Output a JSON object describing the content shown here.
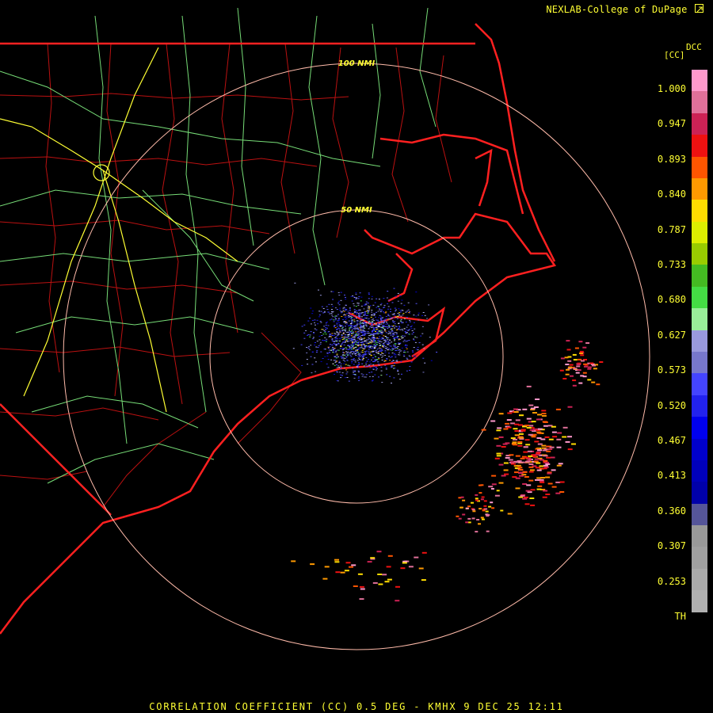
{
  "credit": "NEXLAB-College of DuPage",
  "credit_icon": "external-link-icon",
  "footer": "CORRELATION COEFFICIENT (CC) 0.5 DEG - KMHX 9 DEC 25 12:11",
  "legend": {
    "code": "DCC",
    "unit": "[CC]",
    "labels": [
      "1.000",
      "0.947",
      "0.893",
      "0.840",
      "0.787",
      "0.733",
      "0.680",
      "0.627",
      "0.573",
      "0.520",
      "0.467",
      "0.413",
      "0.360",
      "0.307",
      "0.253",
      "TH"
    ],
    "colors": [
      "#ff99cc",
      "#e0709a",
      "#cc2255",
      "#ee1111",
      "#ff5500",
      "#ff9900",
      "#ffdd00",
      "#ddee00",
      "#99cc00",
      "#44bb22",
      "#44dd44",
      "#99ee99",
      "#9999dd",
      "#7777cc",
      "#4444ff",
      "#2222ee",
      "#0000ee",
      "#0000cc",
      "#0000bb",
      "#0000aa",
      "#555599",
      "#999999",
      "#a0a0a0",
      "#aaaaaa",
      "#b0b0b0",
      "#000000"
    ]
  },
  "map": {
    "radar_site": "KMHX",
    "ring_labels": [
      "100 NMI",
      "50 NMI"
    ],
    "colors": {
      "state_border": "#ff2222",
      "county_lines": "#cc1111",
      "highways": "#88ee88",
      "interstates": "#ffff44",
      "range_rings": "#ffbbaa",
      "coast": "#ff2020"
    }
  }
}
